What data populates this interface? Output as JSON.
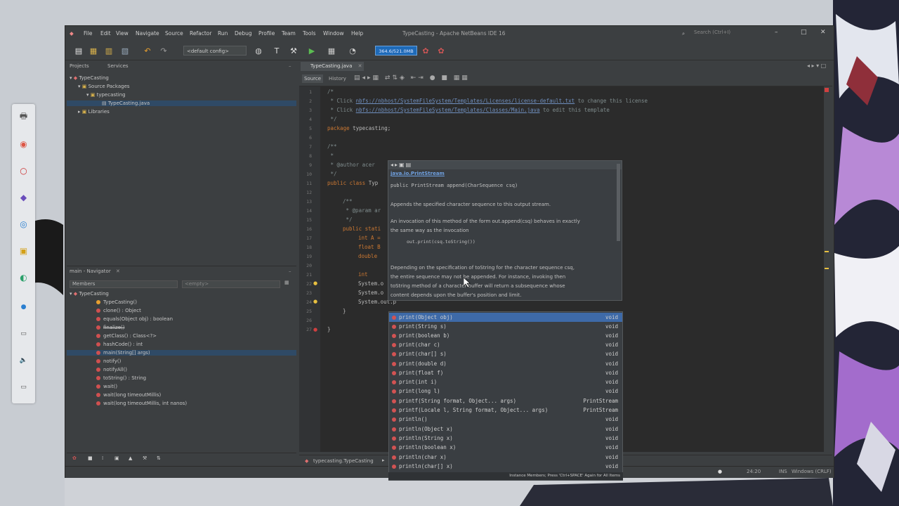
{
  "window": {
    "title": "TypeCasting - Apache NetBeans IDE 16",
    "search_placeholder": "Search (Ctrl+I)"
  },
  "menu": [
    "File",
    "Edit",
    "View",
    "Navigate",
    "Source",
    "Refactor",
    "Run",
    "Debug",
    "Profile",
    "Team",
    "Tools",
    "Window",
    "Help"
  ],
  "toolbar": {
    "config": "<default config>",
    "memory": "364.6/521.0MB"
  },
  "projects_panel": {
    "tabs": [
      "Projects",
      "Services"
    ],
    "tree": [
      "TypeCasting",
      "Source Packages",
      "typecasting",
      "TypeCasting.java",
      "Libraries"
    ]
  },
  "navigator": {
    "title": "main - Navigator",
    "filter": "Members",
    "empty": "<empty>",
    "root": "TypeCasting",
    "members": [
      "TypeCasting()",
      "clone() : Object",
      "equals(Object obj) : boolean",
      "finalize()",
      "getClass() : Class<?>",
      "hashCode() : int",
      "main(String[] args)",
      "notify()",
      "notifyAll()",
      "toString() : String",
      "wait()",
      "wait(long timeoutMillis)",
      "wait(long timeoutMillis, int nanos)"
    ]
  },
  "editor": {
    "tab": "TypeCasting.java",
    "subtabs": [
      "Source",
      "History"
    ],
    "line_numbers": [
      "1",
      "2",
      "3",
      "4",
      "5",
      "6",
      "7",
      "8",
      "9",
      "10",
      "11",
      "12",
      "13",
      "14",
      "15",
      "16",
      "17",
      "18",
      "19",
      "20",
      "21",
      "22",
      "23",
      "24",
      "25",
      "26",
      "27"
    ],
    "comment1": "/*",
    "comment2a": " * Click ",
    "comment2link": "nbfs://nbhost/SystemFileSystem/Templates/Licenses/license-default.txt",
    "comment2b": " to change this license",
    "comment3a": " * Click ",
    "comment3link": "nbfs://nbhost/SystemFileSystem/Templates/Classes/Main.java",
    "comment3b": " to edit this template",
    "comment4": " */",
    "package_kw": "package",
    "package_name": " typecasting;",
    "doc1": "/**",
    "doc2": " *",
    "doc3": " * @author acer",
    "doc4": " */",
    "class_kw": "public class",
    "class_name": " Typ",
    "m1": "/**",
    "m2": " * @param ar",
    "m3": " */",
    "main_kw": "public stati",
    "v1": "int A = ",
    "v2": "float B ",
    "v3": "double ",
    "v4": "int ",
    "s1": "System.o",
    "s2": "System.o",
    "s3": "System.out.p",
    "close1": "}",
    "close2": "}"
  },
  "doc_popup": {
    "class": "java.io.PrintStream",
    "signature": "public PrintStream append(CharSequence csq)",
    "p1": "Appends the specified character sequence to this output stream.",
    "p2a": "An invocation of this method of the form out.append(csq) behaves in exactly",
    "p2b": "the same way as the invocation",
    "code": "out.print(csq.toString())",
    "p3a": "Depending on the specification of toString for the character sequence csq,",
    "p3b": "the entire sequence may not be appended. For instance, invoking then",
    "p3c": "toString method of a character buffer will return a subsequence whose",
    "p3d": "content depends upon the buffer's position and limit."
  },
  "completion": {
    "items": [
      {
        "name": "print(Object obj)",
        "ret": "void"
      },
      {
        "name": "print(String s)",
        "ret": "void"
      },
      {
        "name": "print(boolean b)",
        "ret": "void"
      },
      {
        "name": "print(char c)",
        "ret": "void"
      },
      {
        "name": "print(char[] s)",
        "ret": "void"
      },
      {
        "name": "print(double d)",
        "ret": "void"
      },
      {
        "name": "print(float f)",
        "ret": "void"
      },
      {
        "name": "print(int i)",
        "ret": "void"
      },
      {
        "name": "print(long l)",
        "ret": "void"
      },
      {
        "name": "printf(String format, Object... args)",
        "ret": "PrintStream"
      },
      {
        "name": "printf(Locale l, String format, Object... args)",
        "ret": "PrintStream"
      },
      {
        "name": "println()",
        "ret": "void"
      },
      {
        "name": "println(Object x)",
        "ret": "void"
      },
      {
        "name": "println(String x)",
        "ret": "void"
      },
      {
        "name": "println(boolean x)",
        "ret": "void"
      },
      {
        "name": "println(char x)",
        "ret": "void"
      },
      {
        "name": "println(char[] x)",
        "ret": "void"
      }
    ],
    "hint": "Instance Members; Press 'Ctrl+SPACE' Again for All Items"
  },
  "breadcrumb": "typecasting.TypeCasting",
  "status": {
    "position": "24:20",
    "mode": "INS",
    "line_ending": "Windows (CRLF)"
  },
  "colors": {
    "accent": "#3e6aa8",
    "editor_bg": "#2b2b2b",
    "keyword": "#cc7832"
  }
}
